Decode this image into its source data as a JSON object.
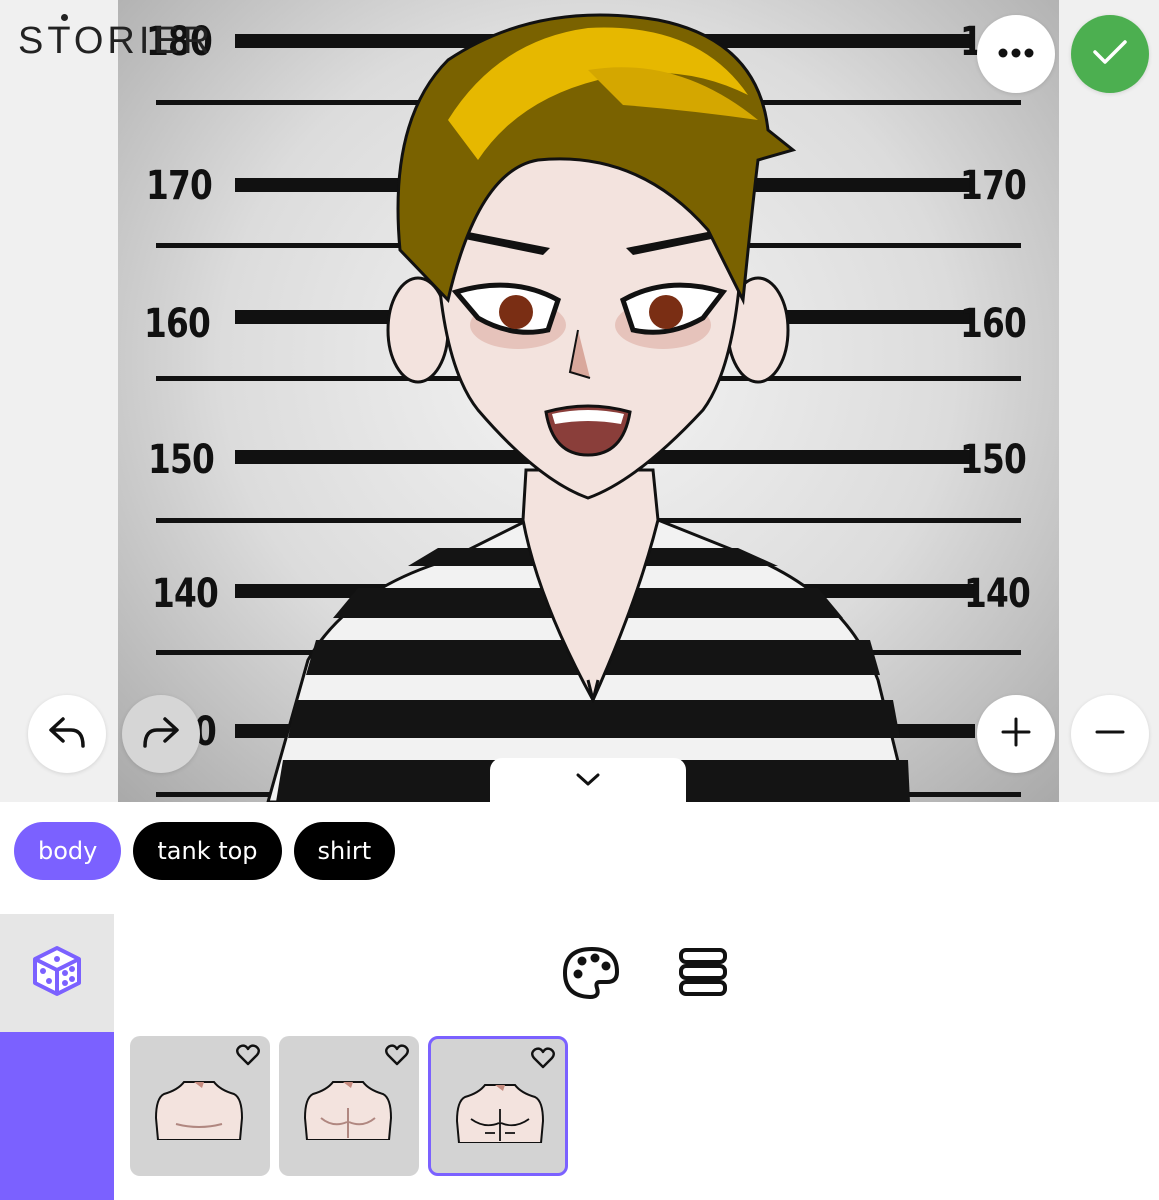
{
  "app": {
    "logo_text": "STORIER"
  },
  "canvas": {
    "height_labels_left": [
      "180",
      "170",
      "160",
      "150",
      "140",
      "0"
    ],
    "height_labels_right": [
      "1",
      "170",
      "160",
      "150",
      "140"
    ]
  },
  "toolbar": {
    "more_icon": "more-icon",
    "confirm_icon": "check-icon",
    "undo_icon": "undo-icon",
    "redo_icon": "redo-icon",
    "zoom_in_icon": "plus-icon",
    "zoom_out_icon": "minus-icon",
    "collapse_icon": "chevron-down-icon"
  },
  "categories": [
    {
      "label": "body",
      "active": true
    },
    {
      "label": "tank top",
      "active": false
    },
    {
      "label": "shirt",
      "active": false
    }
  ],
  "tools": {
    "randomize_icon": "dice-icon",
    "color_icon": "palette-icon",
    "layers_icon": "layers-icon"
  },
  "options": [
    {
      "name": "body-option-1",
      "selected": false
    },
    {
      "name": "body-option-2",
      "selected": false
    },
    {
      "name": "body-option-3",
      "selected": true
    }
  ],
  "colors": {
    "accent": "#7b61ff",
    "confirm": "#4caf50",
    "hair": "#7a6200",
    "hair_highlight": "#e6b800",
    "skin": "#f3e3de"
  }
}
